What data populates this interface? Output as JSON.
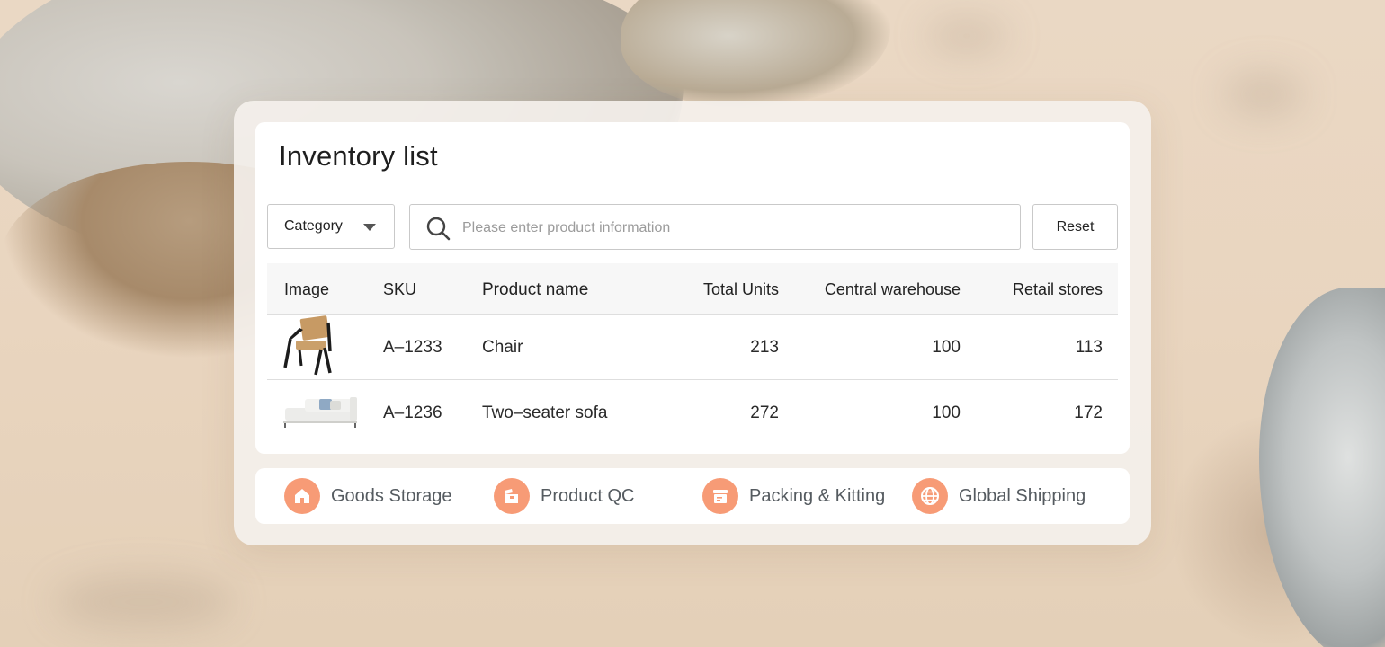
{
  "inventory": {
    "title": "Inventory list",
    "category_label": "Category",
    "search_placeholder": "Please enter product information",
    "reset_label": "Reset",
    "columns": [
      "Image",
      "SKU",
      "Product name",
      "Total Units",
      "Central warehouse",
      "Retail stores"
    ],
    "rows": [
      {
        "image": "chair-image",
        "sku": "A–1233",
        "name": "Chair",
        "total": "213",
        "central": "100",
        "retail": "113"
      },
      {
        "image": "sofa-image",
        "sku": "A–1236",
        "name": "Two–seater sofa",
        "total": "272",
        "central": "100",
        "retail": "172"
      }
    ]
  },
  "services": [
    {
      "label": "Goods Storage",
      "icon": "house-icon"
    },
    {
      "label": "Product QC",
      "icon": "box-icon"
    },
    {
      "label": "Packing & Kitting",
      "icon": "package-icon"
    },
    {
      "label": "Global Shipping",
      "icon": "globe-icon"
    }
  ],
  "colors": {
    "accent": "#f79b76",
    "text": "#1e1e1e",
    "muted": "#555b60"
  }
}
